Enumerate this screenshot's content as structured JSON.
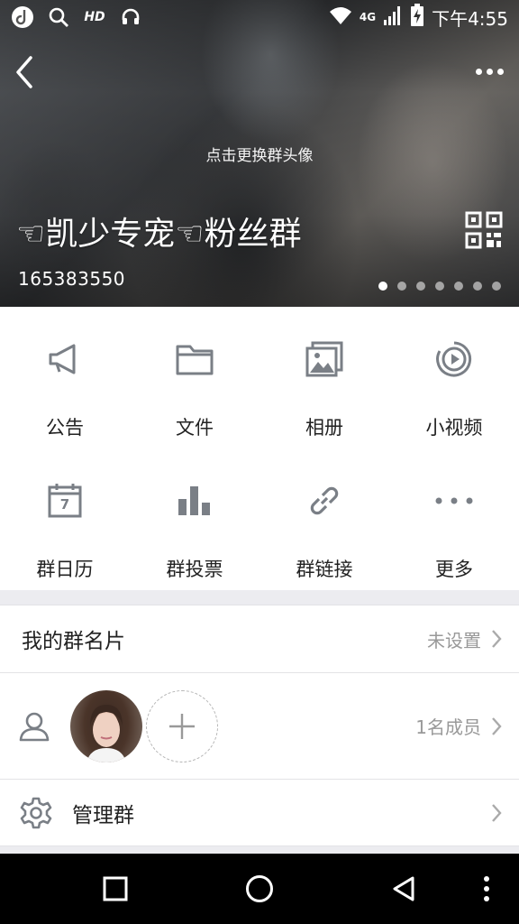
{
  "status_bar": {
    "time": "下午4:55",
    "network": "4G",
    "icons": [
      "music-app-icon",
      "search-icon",
      "hd-icon",
      "headset-icon",
      "wifi-icon",
      "signal-icon",
      "battery-charging-icon"
    ],
    "hd_label": "HD"
  },
  "header": {
    "change_avatar_hint": "点击更换群头像",
    "group_name": "☜凯少专宠☜粉丝群",
    "group_id": "165383550",
    "carousel": {
      "count": 7,
      "active_index": 0
    }
  },
  "features": [
    {
      "label": "公告",
      "icon": "megaphone-icon"
    },
    {
      "label": "文件",
      "icon": "folder-icon"
    },
    {
      "label": "相册",
      "icon": "album-icon"
    },
    {
      "label": "小视频",
      "icon": "video-play-icon"
    },
    {
      "label": "群日历",
      "icon": "calendar-icon",
      "calendar_day": "7"
    },
    {
      "label": "群投票",
      "icon": "bar-chart-icon"
    },
    {
      "label": "群链接",
      "icon": "link-icon"
    },
    {
      "label": "更多",
      "icon": "more-dots-icon"
    }
  ],
  "my_card": {
    "label": "我的群名片",
    "value": "未设置"
  },
  "members": {
    "count_label": "1名成员"
  },
  "manage": {
    "label": "管理群"
  },
  "colors": {
    "icon_gray": "#7a7f86",
    "text_dark": "#222222",
    "text_muted": "#999999",
    "divider": "#e3e3e6"
  }
}
